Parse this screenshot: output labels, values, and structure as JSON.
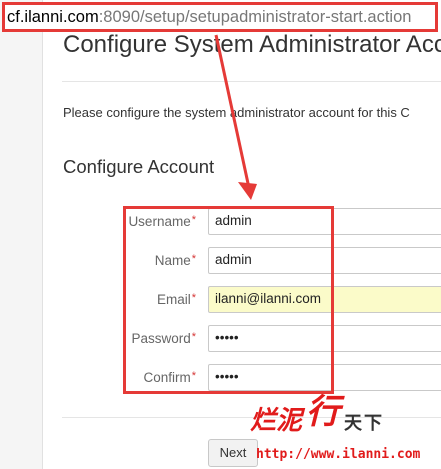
{
  "browser": {
    "url_host": "cf.ilanni.com",
    "url_path": ":8090/setup/setupadministrator-start.action"
  },
  "page": {
    "title": "Configure System Administrator Acc",
    "intro": "Please configure the system administrator account for this C",
    "section_title": "Configure Account"
  },
  "form": {
    "username": {
      "label": "Username",
      "value": "admin"
    },
    "name": {
      "label": "Name",
      "value": "admin"
    },
    "email": {
      "label": "Email",
      "value": "ilanni@ilanni.com"
    },
    "password": {
      "label": "Password",
      "value": "•••••"
    },
    "confirm": {
      "label": "Confirm",
      "value": "•••••"
    },
    "required_marker": "*"
  },
  "actions": {
    "next_label": "Next"
  },
  "watermark": {
    "char1": "烂",
    "char2": "泥",
    "char3": "行",
    "char4": "天下",
    "url": "http://www.ilanni.com"
  },
  "colors": {
    "annotation_red": "#e53a37",
    "autofill_yellow": "#fbfbc9"
  }
}
